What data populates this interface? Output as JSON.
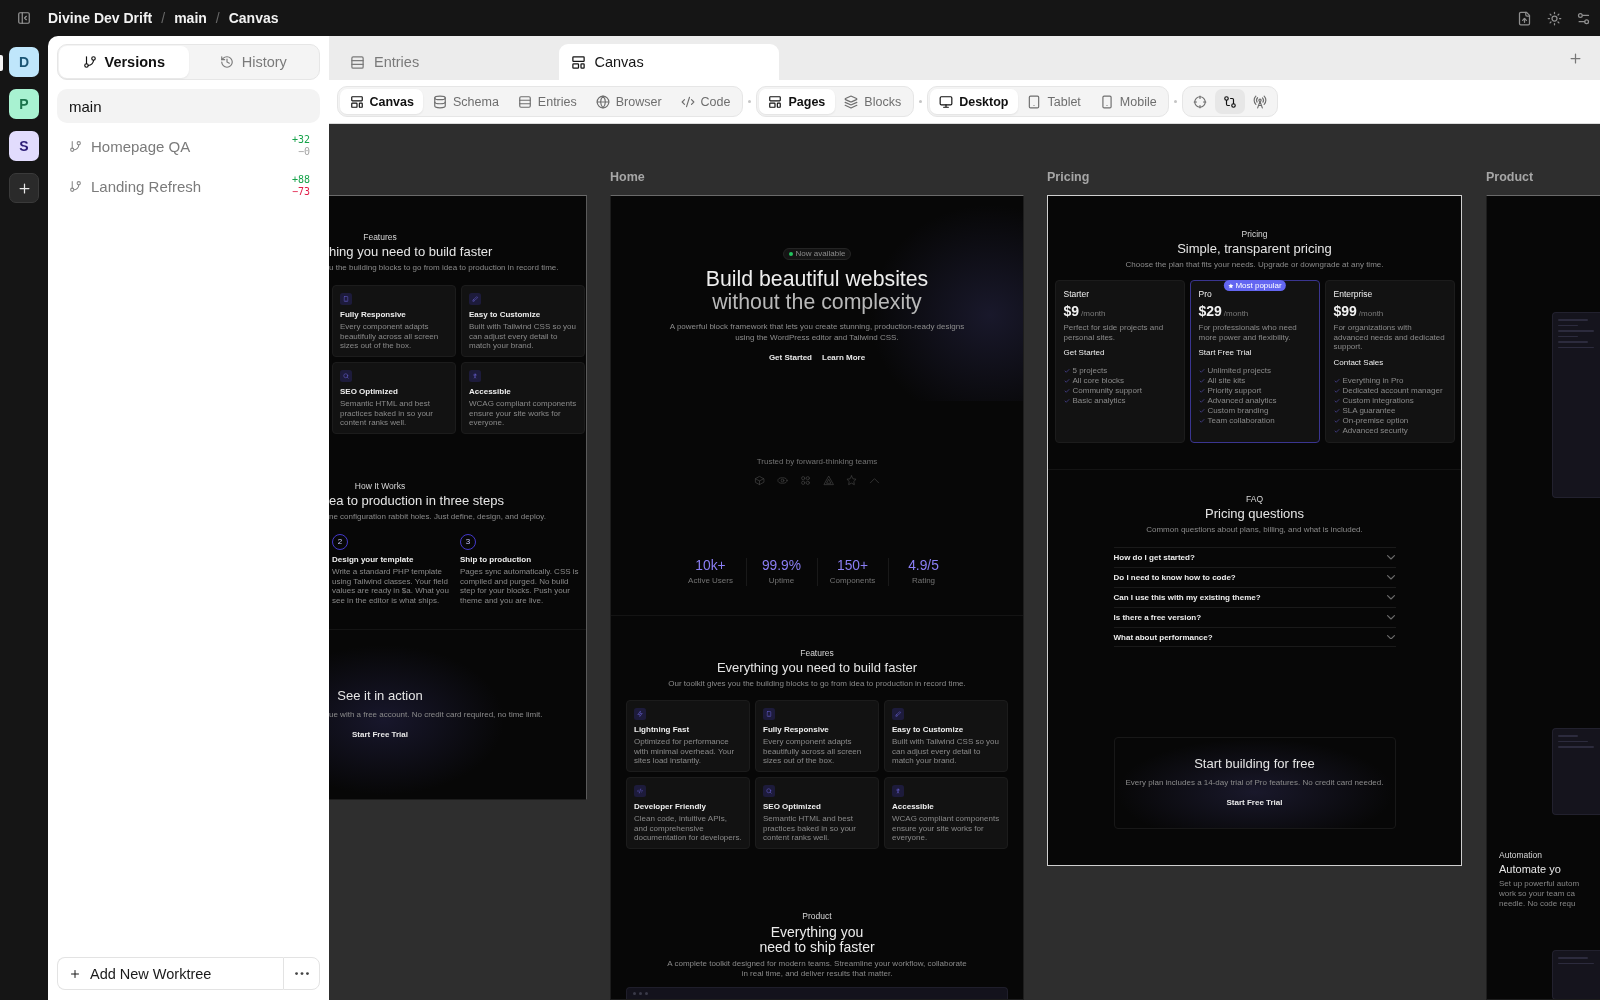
{
  "topbar": {
    "breadcrumbs": [
      "Divine Dev Drift",
      "main",
      "Canvas"
    ],
    "separators": [
      "/",
      "/"
    ]
  },
  "workspaces": [
    {
      "letter": "D",
      "color": "#bfe6fb",
      "selected": true
    },
    {
      "letter": "P",
      "color": "#a8f2d1",
      "selected": false
    },
    {
      "letter": "S",
      "color": "#e2dcfd",
      "selected": false
    }
  ],
  "sidebar": {
    "tabs": [
      {
        "label": "Versions",
        "selected": true
      },
      {
        "label": "History",
        "selected": false
      }
    ],
    "branches": [
      {
        "name": "main",
        "kind": "trunk",
        "selected": true
      },
      {
        "name": "Homepage QA",
        "kind": "worktree",
        "selected": false,
        "diff": [
          {
            "text": "+32",
            "color": "#16a34a"
          },
          {
            "text": "−0",
            "color": "#a3a3a3"
          }
        ]
      },
      {
        "name": "Landing Refresh",
        "kind": "worktree",
        "selected": false,
        "diff": [
          {
            "text": "+88",
            "color": "#16a34a"
          },
          {
            "text": "−73",
            "color": "#e11d48"
          }
        ]
      }
    ],
    "add_button": "Add New Worktree"
  },
  "tabs": [
    {
      "label": "Entries",
      "selected": false
    },
    {
      "label": "Canvas",
      "selected": true
    }
  ],
  "toolbar": {
    "groups": [
      {
        "items": [
          {
            "label": "Canvas",
            "selected": true
          },
          {
            "label": "Schema",
            "selected": false
          },
          {
            "label": "Entries",
            "selected": false
          },
          {
            "label": "Browser",
            "selected": false
          },
          {
            "label": "Code",
            "selected": false
          }
        ]
      },
      {
        "items": [
          {
            "label": "Pages",
            "selected": true
          },
          {
            "label": "Blocks",
            "selected": false
          }
        ]
      },
      {
        "items": [
          {
            "label": "Desktop",
            "selected": true
          },
          {
            "label": "Tablet",
            "selected": false
          },
          {
            "label": "Mobile",
            "selected": false
          }
        ]
      },
      {
        "items": [
          {
            "selected": false
          },
          {
            "selected": true
          },
          {
            "selected": false
          }
        ]
      }
    ]
  },
  "canvas": {
    "frames": [
      {
        "kind": "clipped_left",
        "selected": false,
        "sections": [
          {
            "kind": "features",
            "eyebrow": "Features",
            "title": "hing you need to build faster",
            "subtitle": "u the building blocks to go from idea to production in record time.",
            "cards": [
              {
                "title": "Fully Responsive",
                "text": "Every component adapts beautifully across all screen sizes out of the box."
              },
              {
                "title": "Easy to Customize",
                "text": "Built with Tailwind CSS so you can adjust every detail to match your brand."
              },
              {
                "title": "SEO Optimized",
                "text": "Semantic HTML and best practices baked in so your content ranks well."
              },
              {
                "title": "Accessible",
                "text": "WCAG compliant components ensure your site works for everyone."
              }
            ]
          },
          {
            "kind": "steps",
            "eyebrow": "How It Works",
            "title": "ea to production in three steps",
            "subtitle": "ne configuration rabbit holes. Just define, design, and deploy.",
            "steps": [
              {
                "number": "2",
                "title": "Design your template",
                "text": "Write a standard PHP template using Tailwind classes. Your field values are ready in $a. What you see in the editor is what ships."
              },
              {
                "number": "3",
                "title": "Ship to production",
                "text": "Pages sync automatically. CSS is compiled and purged. No build step for your blocks. Push your theme and you are live."
              }
            ]
          },
          {
            "kind": "cta",
            "title": "See it in action",
            "subtitle": "ue with a free account. No credit card required, no time limit.",
            "button": "Start Free Trial"
          }
        ]
      },
      {
        "label": "Home",
        "kind": "full",
        "selected": false,
        "sections": [
          {
            "kind": "hero",
            "badge": "Now available",
            "title_lines": [
              "Build beautiful websites",
              "without the complexity"
            ],
            "text": "A powerful block framework that lets you create stunning, production-ready designs using the WordPress editor and Tailwind CSS.",
            "buttons": [
              "Get Started",
              "Learn More"
            ]
          },
          {
            "kind": "logos",
            "caption": "Trusted by forward-thinking teams"
          },
          {
            "kind": "stats",
            "stats": [
              {
                "value": "10k+",
                "label": "Active Users"
              },
              {
                "value": "99.9%",
                "label": "Uptime"
              },
              {
                "value": "150+",
                "label": "Components"
              },
              {
                "value": "4.9/5",
                "label": "Rating"
              }
            ]
          },
          {
            "kind": "features",
            "eyebrow": "Features",
            "title": "Everything you need to build faster",
            "subtitle": "Our toolkit gives you the building blocks to go from idea to production in record time.",
            "cards": [
              {
                "title": "Lightning Fast",
                "text": "Optimized for performance with minimal overhead. Your sites load instantly."
              },
              {
                "title": "Fully Responsive",
                "text": "Every component adapts beautifully across all screen sizes out of the box."
              },
              {
                "title": "Easy to Customize",
                "text": "Built with Tailwind CSS so you can adjust every detail to match your brand."
              },
              {
                "title": "Developer Friendly",
                "text": "Clean code, intuitive APIs, and comprehensive documentation for developers."
              },
              {
                "title": "SEO Optimized",
                "text": "Semantic HTML and best practices baked in so your content ranks well."
              },
              {
                "title": "Accessible",
                "text": "WCAG compliant components ensure your site works for everyone."
              }
            ]
          },
          {
            "kind": "product",
            "eyebrow": "Product",
            "title": "Everything you need to ship faster",
            "subtitle": "A complete toolkit designed for modern teams. Streamline your workflow, collaborate in real time, and deliver results that matter."
          }
        ]
      },
      {
        "label": "Pricing",
        "kind": "full",
        "selected": true,
        "sections": [
          {
            "kind": "pricing",
            "eyebrow": "Pricing",
            "title": "Simple, transparent pricing",
            "subtitle": "Choose the plan that fits your needs. Upgrade or downgrade at any time.",
            "plans": [
              {
                "name": "Starter",
                "price": "$9",
                "period": "/month",
                "text": "Perfect for side projects and personal sites.",
                "button": "Get Started",
                "highlighted": false,
                "features": [
                  "5 projects",
                  "All core blocks",
                  "Community support",
                  "Basic analytics"
                ]
              },
              {
                "name": "Pro",
                "badge": "Most popular",
                "price": "$29",
                "period": "/month",
                "text": "For professionals who need more power and flexibility.",
                "button": "Start Free Trial",
                "highlighted": true,
                "features": [
                  "Unlimited projects",
                  "All site kits",
                  "Priority support",
                  "Advanced analytics",
                  "Custom branding",
                  "Team collaboration"
                ]
              },
              {
                "name": "Enterprise",
                "price": "$99",
                "period": "/month",
                "text": "For organizations with advanced needs and dedicated support.",
                "button": "Contact Sales",
                "highlighted": false,
                "features": [
                  "Everything in Pro",
                  "Dedicated account manager",
                  "Custom integrations",
                  "SLA guarantee",
                  "On-premise option",
                  "Advanced security"
                ]
              }
            ]
          },
          {
            "kind": "faq",
            "eyebrow": "FAQ",
            "title": "Pricing questions",
            "subtitle": "Common questions about plans, billing, and what is included.",
            "questions": [
              {
                "question": "How do I get started?",
                "expanded": false
              },
              {
                "question": "Do I need to know how to code?",
                "expanded": false
              },
              {
                "question": "Can I use this with my existing theme?",
                "expanded": false
              },
              {
                "question": "Is there a free version?",
                "expanded": false
              },
              {
                "question": "What about performance?",
                "expanded": false
              }
            ]
          },
          {
            "kind": "cta",
            "title": "Start building for free",
            "subtitle": "Every plan includes a 14-day trial of Pro features. No credit card needed.",
            "button": "Start Free Trial"
          }
        ]
      },
      {
        "label": "Product",
        "kind": "clipped_right",
        "selected": false,
        "sections": [
          {
            "kind": "split",
            "eyebrow": "Automation",
            "title": "Automate yo",
            "text_lines": [
              "Set up powerful autom",
              "work so your team ca",
              "needle. No code requ"
            ]
          }
        ]
      }
    ]
  }
}
